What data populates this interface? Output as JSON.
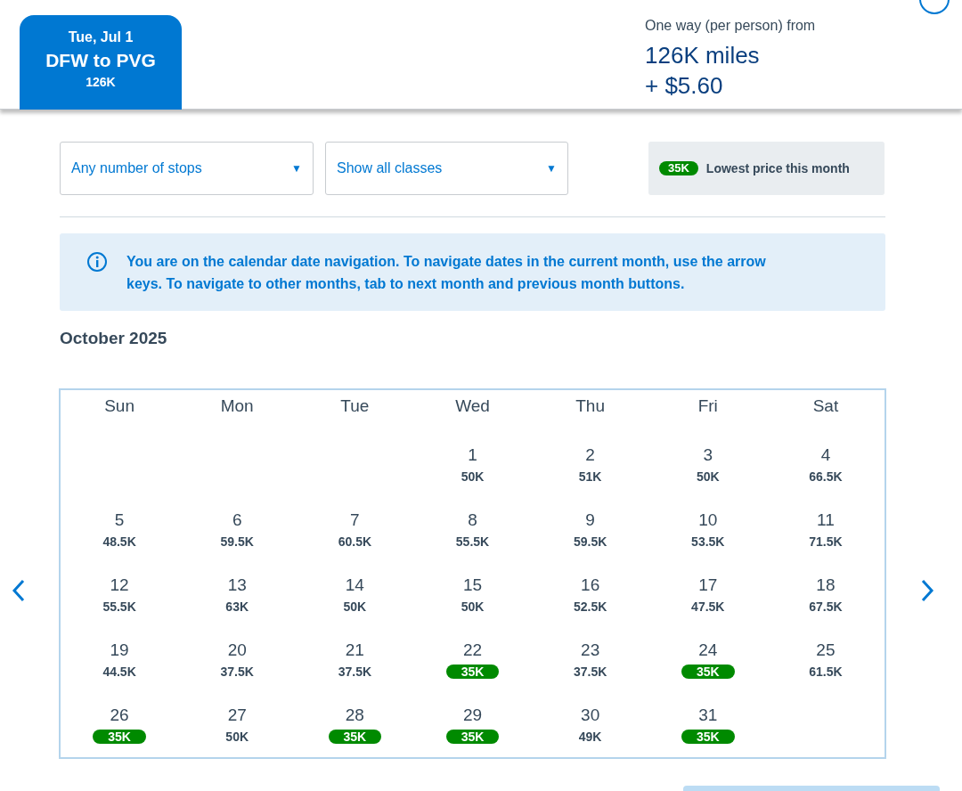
{
  "flight_tab": {
    "date": "Tue, Jul 1",
    "route": "DFW to PVG",
    "price": "126K",
    "selected": true
  },
  "fare": {
    "label": "One way (per person) from",
    "miles": "126K miles",
    "taxes": "+ $5.60"
  },
  "filters": [
    {
      "value": "Any number of stops",
      "icon": "▼"
    },
    {
      "value": "Show all classes",
      "icon": "▼"
    }
  ],
  "legend": {
    "badge": "35K",
    "label": "Lowest price this month"
  },
  "info_message": "You are on the calendar date navigation. To navigate dates in the current month, use the arrow keys. To navigate to other months, tab to next month and previous month buttons.",
  "month_title": "October 2025",
  "calendar": {
    "weekdays": [
      "Sun",
      "Mon",
      "Tue",
      "Wed",
      "Thu",
      "Fri",
      "Sat"
    ],
    "days": [
      {
        "date": "1",
        "price": "50K",
        "lowest": false
      },
      {
        "date": "2",
        "price": "51K",
        "lowest": false
      },
      {
        "date": "3",
        "price": "50K",
        "lowest": false
      },
      {
        "date": "4",
        "price": "66.5K",
        "lowest": false
      },
      {
        "date": "5",
        "price": "48.5K",
        "lowest": false
      },
      {
        "date": "6",
        "price": "59.5K",
        "lowest": false
      },
      {
        "date": "7",
        "price": "60.5K",
        "lowest": false
      },
      {
        "date": "8",
        "price": "55.5K",
        "lowest": false
      },
      {
        "date": "9",
        "price": "59.5K",
        "lowest": false
      },
      {
        "date": "10",
        "price": "53.5K",
        "lowest": false
      },
      {
        "date": "11",
        "price": "71.5K",
        "lowest": false
      },
      {
        "date": "12",
        "price": "55.5K",
        "lowest": false
      },
      {
        "date": "13",
        "price": "63K",
        "lowest": false
      },
      {
        "date": "14",
        "price": "50K",
        "lowest": false
      },
      {
        "date": "15",
        "price": "50K",
        "lowest": false
      },
      {
        "date": "16",
        "price": "52.5K",
        "lowest": false
      },
      {
        "date": "17",
        "price": "47.5K",
        "lowest": false
      },
      {
        "date": "18",
        "price": "67.5K",
        "lowest": false
      },
      {
        "date": "19",
        "price": "44.5K",
        "lowest": false
      },
      {
        "date": "20",
        "price": "37.5K",
        "lowest": false
      },
      {
        "date": "21",
        "price": "37.5K",
        "lowest": false
      },
      {
        "date": "22",
        "price": "35K",
        "lowest": true
      },
      {
        "date": "23",
        "price": "37.5K",
        "lowest": false
      },
      {
        "date": "24",
        "price": "35K",
        "lowest": true
      },
      {
        "date": "25",
        "price": "61.5K",
        "lowest": false
      },
      {
        "date": "26",
        "price": "35K",
        "lowest": true
      },
      {
        "date": "27",
        "price": "50K",
        "lowest": false
      },
      {
        "date": "28",
        "price": "35K",
        "lowest": true
      },
      {
        "date": "29",
        "price": "35K",
        "lowest": true
      },
      {
        "date": "30",
        "price": "49K",
        "lowest": false
      },
      {
        "date": "31",
        "price": "35K",
        "lowest": true
      }
    ]
  }
}
